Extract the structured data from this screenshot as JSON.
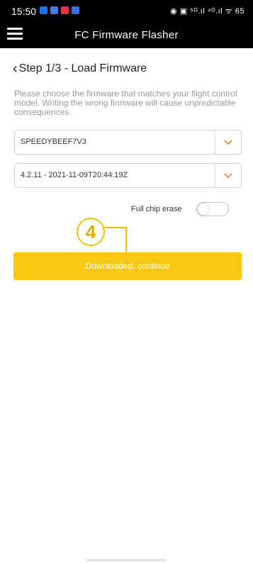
{
  "status_bar": {
    "time": "15:50",
    "app_icons": [
      "#1e6ff3",
      "#3f7cf5",
      "#e8344a",
      "#3a6df0"
    ],
    "right_icons_text": "◉ ▣ ⁵ᴳ.ıl ⁴ᴳ.ıl ᯤ 65"
  },
  "app_bar": {
    "title": "FC Firmware Flasher",
    "menu_icon": "hamburger-icon"
  },
  "step": {
    "back_icon": "chevron-left-icon",
    "title": "Step 1/3 - Load Firmware"
  },
  "description": "Please choose the firmware that matches your flight control model. Writing the wrong firmware will cause unpredictable consequences.",
  "target_select": {
    "value": "SPEEDYBEEF7V3",
    "icon": "chevron-down-icon"
  },
  "version_select": {
    "value": "4.2.11 - 2021-11-09T20:44:19Z",
    "icon": "chevron-down-icon"
  },
  "full_chip_erase": {
    "label": "Full chip erase",
    "enabled": false
  },
  "annotation": {
    "number": "4"
  },
  "continue_button": {
    "label": "Downloaded, continue"
  },
  "colors": {
    "accent": "#f9c812",
    "chevron": "#f08a24",
    "annotation": "#f2be00"
  }
}
